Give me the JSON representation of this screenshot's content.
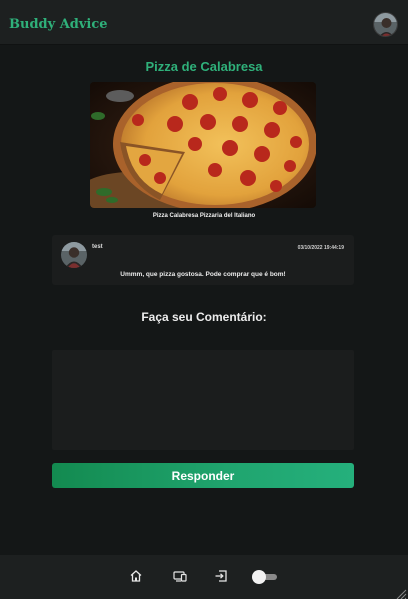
{
  "header": {
    "brand": "Buddy Advice",
    "avatar_icon": "user-avatar"
  },
  "post": {
    "title": "Pizza de Calabresa",
    "image_icon": "pepperoni-pizza-photo",
    "caption": "Pizza Calabresa Pizzaria del Italiano"
  },
  "comments": [
    {
      "user": "test",
      "date": "03/10/2022 19:44:19",
      "text": "Ummm, que pizza gostosa. Pode comprar que é bom!"
    }
  ],
  "comment_form": {
    "title": "Faça seu Comentário:",
    "input_value": "",
    "submit_label": "Responder"
  },
  "footer": {
    "icons": [
      "home-icon",
      "devices-icon",
      "logout-icon",
      "theme-toggle"
    ]
  },
  "colors": {
    "accent": "#2fb07a",
    "button_start": "#138a50",
    "button_end": "#25b07c",
    "background": "#141717",
    "bar": "#1d2020",
    "card": "#1b1d1d"
  }
}
